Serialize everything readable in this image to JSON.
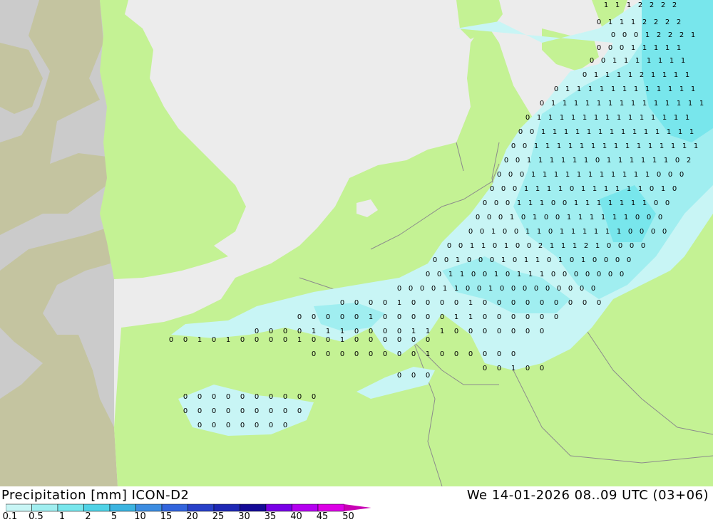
{
  "header": {
    "title": "Precipitation [mm] ICON-D2",
    "datetime": "We 14-01-2026 08..09 UTC (03+06)"
  },
  "legend": {
    "ticks": [
      "0.1",
      "0.5",
      "1",
      "2",
      "5",
      "10",
      "15",
      "20",
      "25",
      "30",
      "35",
      "40",
      "45",
      "50"
    ],
    "colors": [
      "#c8f5f5",
      "#a0eef0",
      "#78e6ec",
      "#50d2e6",
      "#3cb4e0",
      "#3c8ce0",
      "#3264dc",
      "#2840c8",
      "#1e28b4",
      "#140a96",
      "#7800e6",
      "#b400f0",
      "#dc00e6",
      "#c800b4",
      "#a00096"
    ]
  },
  "map": {
    "colors": {
      "sea": "#ececec",
      "land_in_domain": "#c4f294",
      "land_outside": "#c4c4a0",
      "sea_outside": "#cbcbcb",
      "border_line": "#8c8c8c"
    },
    "precip_value_labels": [
      "0",
      "1",
      "2"
    ]
  }
}
